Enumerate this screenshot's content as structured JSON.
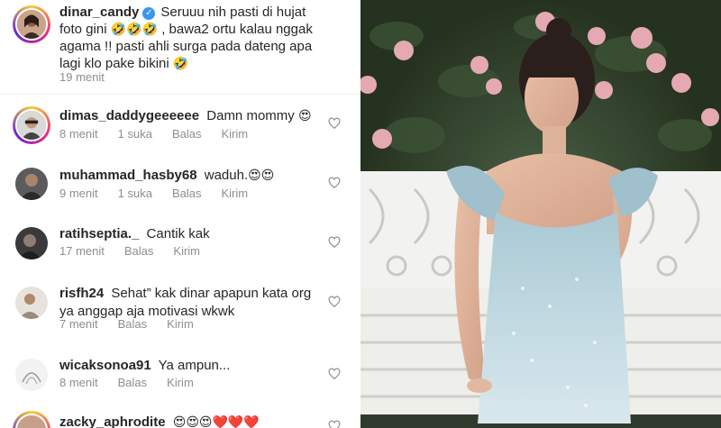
{
  "caption": {
    "username": "dinar_candy",
    "verified_icon": "verified-badge-icon",
    "text_line1": "Seruuu nih pasti di hujat",
    "text_line2_a": "foto gini",
    "text_line2_b": ", bawa2 ortu kalau nggak",
    "text_line3": "agama !! pasti ahli surga pada dateng apa",
    "text_line4": "lagi klo pake bikini",
    "emoji_rofl": "🤣",
    "time": "19 menit"
  },
  "comments": [
    {
      "username": "dimas_daddygeeeeee",
      "text": "Damn mommy",
      "emojis": "😍",
      "time": "8 menit",
      "likes": "1 suka",
      "reply": "Balas",
      "send": "Kirim"
    },
    {
      "username": "muhammad_hasby68",
      "text": "waduh.",
      "emojis": "😍😍",
      "time": "9 menit",
      "likes": "1 suka",
      "reply": "Balas",
      "send": "Kirim"
    },
    {
      "username": "ratihseptia._",
      "text": "Cantik kak",
      "emojis": "",
      "time": "17 menit",
      "reply": "Balas",
      "send": "Kirim"
    },
    {
      "username": "risfh24",
      "text_line1": "Sehat” kak dinar apapun kata org",
      "text_line2": "ya anggap aja motivasi wkwk",
      "time": "7 menit",
      "reply": "Balas",
      "send": "Kirim"
    },
    {
      "username": "wicaksonoa91",
      "text": "Ya ampun...",
      "time": "8 menit",
      "reply": "Balas",
      "send": "Kirim"
    },
    {
      "username": "zacky_aphrodite",
      "emojis": "😍😍😍❤️❤️❤️"
    }
  ],
  "colors": {
    "text": "#262626",
    "muted": "#8e8e8e",
    "verified": "#3897f0"
  }
}
